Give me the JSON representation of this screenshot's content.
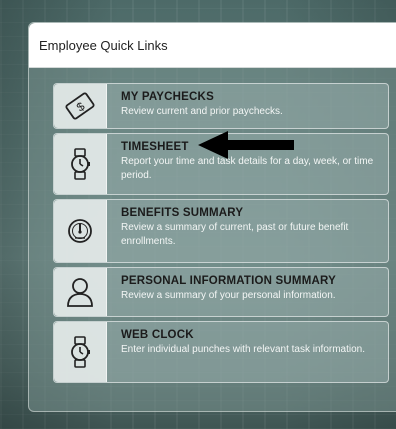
{
  "panel": {
    "title": "Employee Quick Links"
  },
  "links": [
    {
      "title": "MY PAYCHECKS",
      "description": "Review current and prior paychecks.",
      "icon": "paycheck-icon"
    },
    {
      "title": "TIMESHEET",
      "description": "Report your time and task details for a day, week, or time period.",
      "icon": "watch-icon"
    },
    {
      "title": "BENEFITS SUMMARY",
      "description": "Review a summary of current, past or future benefit enrollments.",
      "icon": "gauge-icon"
    },
    {
      "title": "PERSONAL INFORMATION SUMMARY",
      "description": "Review a summary of your personal information.",
      "icon": "person-icon"
    },
    {
      "title": "WEB CLOCK",
      "description": "Enter individual punches with relevant task information.",
      "icon": "watch-icon"
    }
  ],
  "annotation": {
    "icon": "arrow-left-icon",
    "color": "#000000"
  }
}
